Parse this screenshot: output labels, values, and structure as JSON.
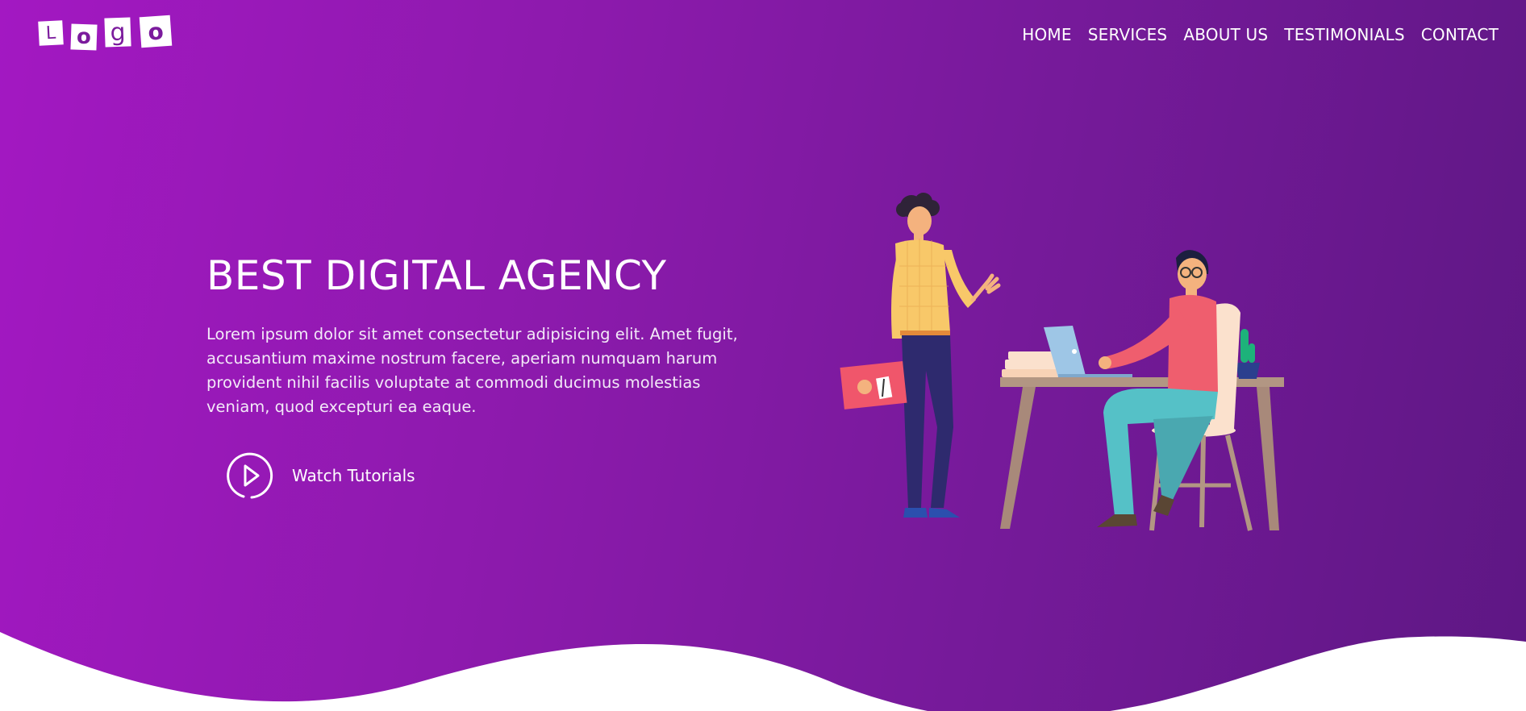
{
  "logo": {
    "letters": [
      "L",
      "o",
      "g",
      "o"
    ]
  },
  "nav": {
    "items": [
      {
        "label": "HOME"
      },
      {
        "label": "SERVICES"
      },
      {
        "label": "ABOUT US"
      },
      {
        "label": "TESTIMONIALS"
      },
      {
        "label": "CONTACT"
      }
    ]
  },
  "hero": {
    "title": "BEST DIGITAL AGENCY",
    "text": "Lorem ipsum dolor sit amet consectetur adipisicing elit. Amet fugit, accusantium maxime nostrum facere, aperiam numquam harum provident nihil facilis voluptate at commodi ducimus molestias veniam, quod excepturi ea eaque.",
    "cta_label": "Watch Tutorials"
  },
  "colors": {
    "gradient_start": "#a318c2",
    "gradient_end": "#5e1784",
    "text": "#ffffff",
    "wave": "#ffffff"
  },
  "icons": {
    "play": "play-circle-icon"
  }
}
